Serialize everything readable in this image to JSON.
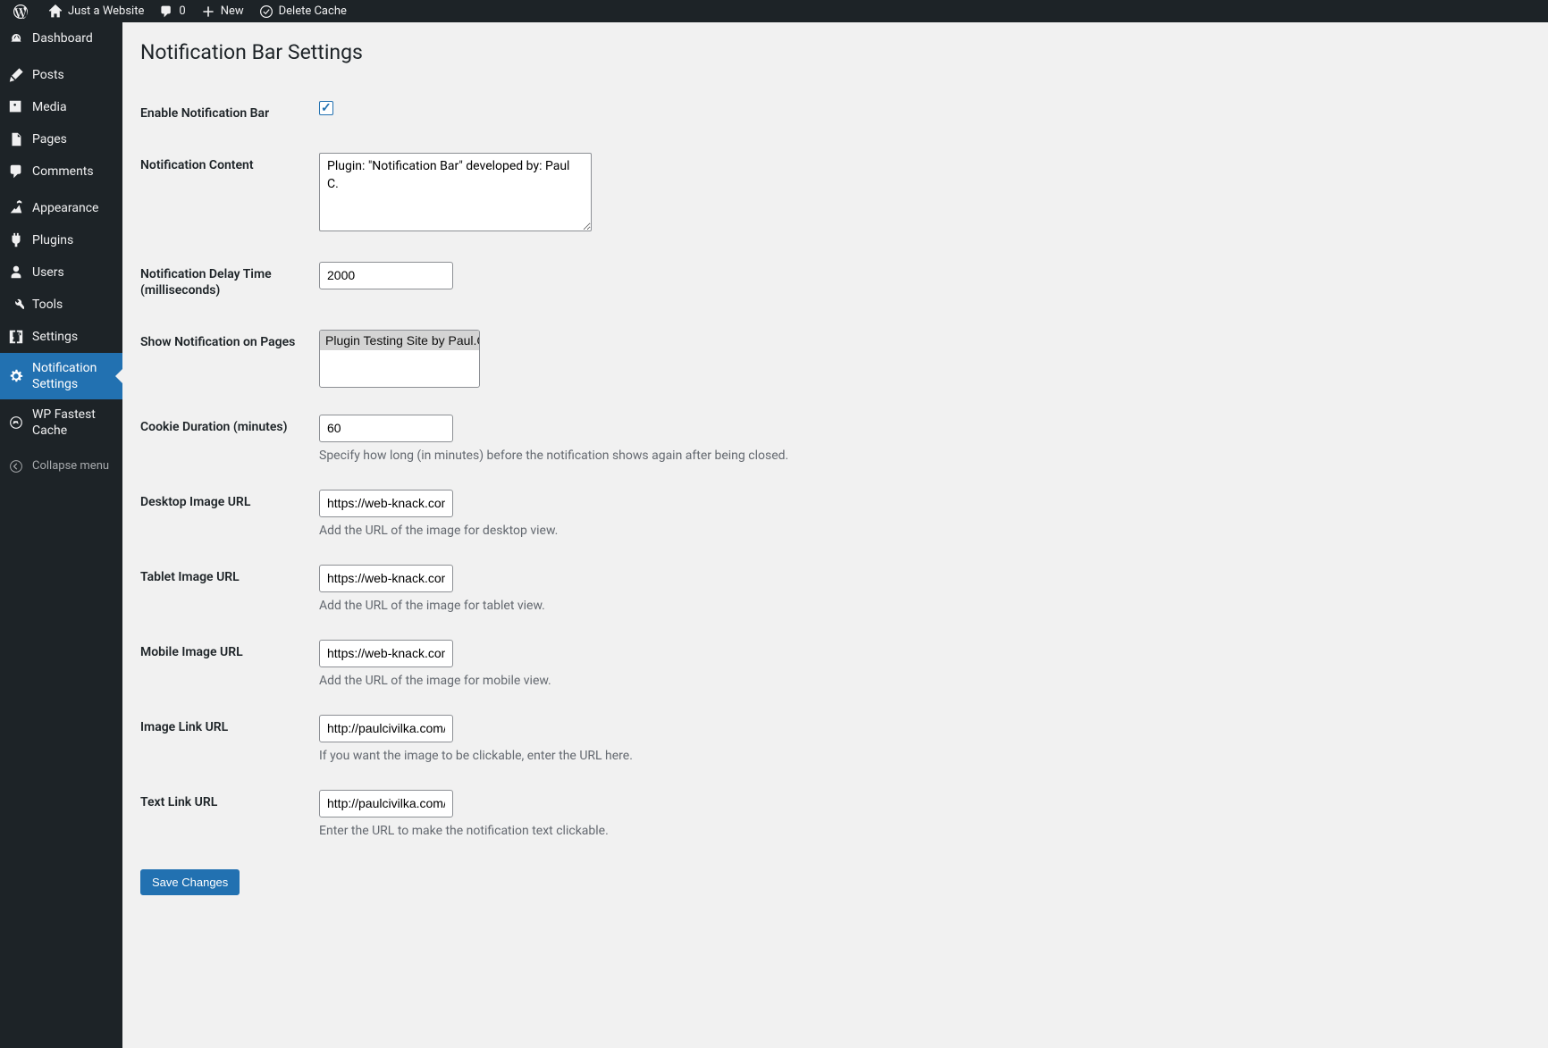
{
  "adminBar": {
    "siteTitle": "Just a Website",
    "commentsCount": "0",
    "newLabel": "New",
    "deleteCacheLabel": "Delete Cache"
  },
  "sidebar": {
    "dashboard": "Dashboard",
    "posts": "Posts",
    "media": "Media",
    "pages": "Pages",
    "comments": "Comments",
    "appearance": "Appearance",
    "plugins": "Plugins",
    "users": "Users",
    "tools": "Tools",
    "settings": "Settings",
    "notificationSettings": "Notification Settings",
    "wpFastestCache": "WP Fastest Cache",
    "collapseMenu": "Collapse menu"
  },
  "page": {
    "title": "Notification Bar Settings"
  },
  "form": {
    "enableLabel": "Enable Notification Bar",
    "contentLabel": "Notification Content",
    "contentValue": "Plugin: \"Notification Bar\" developed by: Paul C.",
    "delayLabel": "Notification Delay Time (milliseconds)",
    "delayValue": "2000",
    "showOnPagesLabel": "Show Notification on Pages",
    "pageOption1": "Plugin Testing Site by Paul.C",
    "cookieDurationLabel": "Cookie Duration (minutes)",
    "cookieDurationValue": "60",
    "cookieDurationDesc": "Specify how long (in minutes) before the notification shows again after being closed.",
    "desktopImageLabel": "Desktop Image URL",
    "desktopImageValue": "https://web-knack.com/w",
    "desktopImageDesc": "Add the URL of the image for desktop view.",
    "tabletImageLabel": "Tablet Image URL",
    "tabletImageValue": "https://web-knack.com/w",
    "tabletImageDesc": "Add the URL of the image for tablet view.",
    "mobileImageLabel": "Mobile Image URL",
    "mobileImageValue": "https://web-knack.com/w",
    "mobileImageDesc": "Add the URL of the image for mobile view.",
    "imageLinkLabel": "Image Link URL",
    "imageLinkValue": "http://paulcivilka.com/",
    "imageLinkDesc": "If you want the image to be clickable, enter the URL here.",
    "textLinkLabel": "Text Link URL",
    "textLinkValue": "http://paulcivilka.com/",
    "textLinkDesc": "Enter the URL to make the notification text clickable.",
    "saveButton": "Save Changes"
  }
}
